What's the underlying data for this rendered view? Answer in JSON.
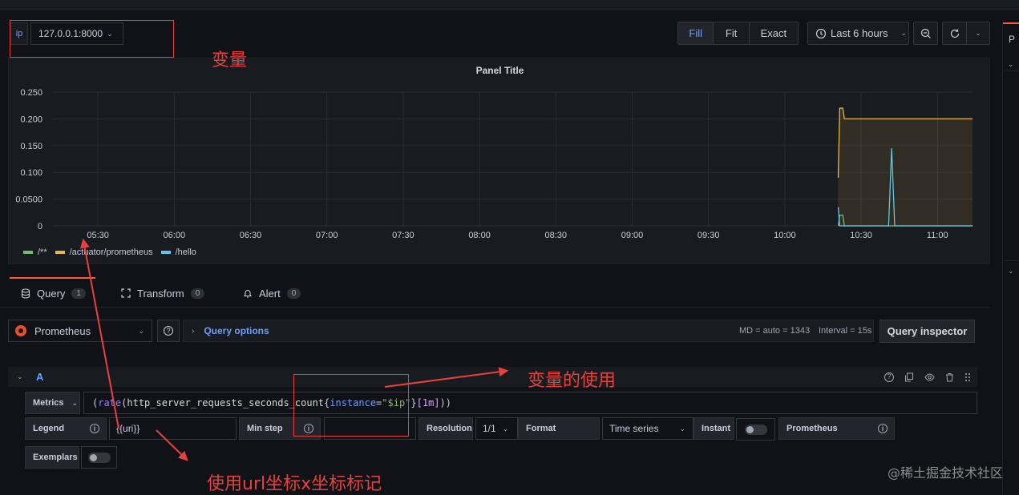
{
  "variable": {
    "label": "ip",
    "value": "127.0.0.1:8000"
  },
  "toolbar": {
    "fit_options": [
      "Fill",
      "Fit",
      "Exact"
    ],
    "active_fit": "Fill",
    "time_range": "Last 6 hours"
  },
  "panel": {
    "title": "Panel Title"
  },
  "chart_data": {
    "type": "line",
    "x_ticks": [
      "05:30",
      "06:00",
      "06:30",
      "07:00",
      "07:30",
      "08:00",
      "08:30",
      "09:00",
      "09:30",
      "10:00",
      "10:30",
      "11:00"
    ],
    "y_ticks": [
      "0.250",
      "0.200",
      "0.150",
      "0.100",
      "0.0500",
      "0"
    ],
    "ylim": [
      0,
      0.25
    ],
    "grid": true,
    "legend_position": "bottom-left",
    "series": [
      {
        "name": "/**",
        "color": "#73bf69",
        "points": [
          [
            10.35,
            0
          ],
          [
            10.36,
            0.02
          ],
          [
            10.38,
            0.02
          ],
          [
            10.39,
            0
          ],
          [
            11.23,
            0
          ]
        ]
      },
      {
        "name": "/actuator/prometheus",
        "color": "#e5b84b",
        "points": [
          [
            10.35,
            0.09
          ],
          [
            10.36,
            0.22
          ],
          [
            10.38,
            0.22
          ],
          [
            10.39,
            0.2
          ],
          [
            11.23,
            0.2
          ]
        ]
      },
      {
        "name": "/hello",
        "color": "#5cc8e8",
        "points": [
          [
            10.35,
            0.035
          ],
          [
            10.36,
            0
          ],
          [
            10.68,
            0
          ],
          [
            10.7,
            0.145
          ],
          [
            10.72,
            0
          ],
          [
            11.23,
            0
          ]
        ]
      }
    ]
  },
  "tabs": [
    {
      "label": "Query",
      "count": "1"
    },
    {
      "label": "Transform",
      "count": "0"
    },
    {
      "label": "Alert",
      "count": "0"
    }
  ],
  "datasource": {
    "name": "Prometheus"
  },
  "query_options": {
    "title": "Query options",
    "md": "MD = auto = 1343",
    "interval": "Interval = 15s"
  },
  "query_inspector": "Query inspector",
  "query": {
    "ref": "A",
    "metrics_label": "Metrics",
    "expr_parts": {
      "p1": "(",
      "fn": "rate",
      "p2": "(",
      "metric": "http_server_requests_seconds_count",
      "p3": "{",
      "label": "instance",
      "eq": "=",
      "value": "\"$ip\"",
      "p4": "}",
      "range": "[1m]",
      "p5": "))"
    },
    "legend_label": "Legend",
    "legend_value": "{{uri}}",
    "min_step_label": "Min step",
    "resolution_label": "Resolution",
    "resolution_value": "1/1",
    "format_label": "Format",
    "format_value": "Time series",
    "instant_label": "Instant",
    "ds_type_label": "Prometheus",
    "exemplars_label": "Exemplars"
  },
  "annotations": {
    "variable": "变量",
    "usage": "变量的使用",
    "legend": "使用url坐标x坐标标记"
  },
  "watermark": "@稀土掘金技术社区",
  "colors": {
    "accent": "#6e9fff",
    "annotation": "#e8403c",
    "tab_active": "#f55f3e"
  }
}
